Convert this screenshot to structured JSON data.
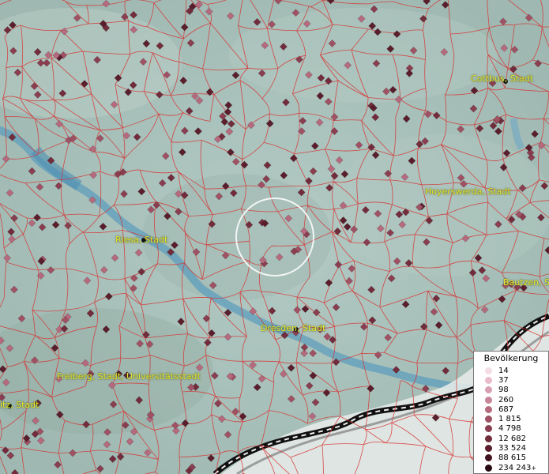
{
  "map": {
    "cities": [
      {
        "name": "Cottbus, Stadt"
      },
      {
        "name": "Hoyerswerda, Stadt"
      },
      {
        "name": "Riesa, Stadt"
      },
      {
        "name": "Bautzen, Stadt"
      },
      {
        "name": "Dresden, Stadt"
      },
      {
        "name": "Freiberg, Stadt, Universitätsstadt"
      },
      {
        "name": "itz, Stadt"
      }
    ]
  },
  "legend": {
    "title": "Bevölkerung",
    "items": [
      {
        "label": "14",
        "color": "#f5dde4"
      },
      {
        "label": "37",
        "color": "#e8bcc8"
      },
      {
        "label": "98",
        "color": "#d8a0b0"
      },
      {
        "label": "260",
        "color": "#c98598"
      },
      {
        "label": "687",
        "color": "#b56a7e"
      },
      {
        "label": "1 815",
        "color": "#a05264"
      },
      {
        "label": "4 798",
        "color": "#8a3e50"
      },
      {
        "label": "12 682",
        "color": "#722c3c"
      },
      {
        "label": "33 524",
        "color": "#5a1e2c"
      },
      {
        "label": "88 615",
        "color": "#42121e"
      },
      {
        "label": "234 243",
        "color": "#2a0a12",
        "suffix": "+"
      }
    ]
  }
}
